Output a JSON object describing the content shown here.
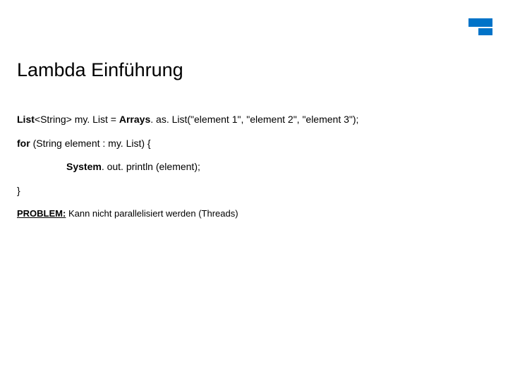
{
  "logo": {
    "accent": "#0073c8"
  },
  "title": "Lambda Einführung",
  "code": {
    "line1_pre": "List",
    "line1_generic": "<String>",
    "line1_mid": " my. List = ",
    "line1_bold2": "Arrays",
    "line1_post": ". as. List(\"element 1\", \"element 2\", \"element 3\");",
    "line2_pre": "for ",
    "line2_paren": "(String ",
    "line2_rest": "element : my. List) {",
    "line3_bold": "System",
    "line3_rest": ". out. println (element);",
    "line4": "}"
  },
  "problem": {
    "label": "PROBLEM:",
    "text": " Kann nicht parallelisiert werden (Threads)"
  }
}
